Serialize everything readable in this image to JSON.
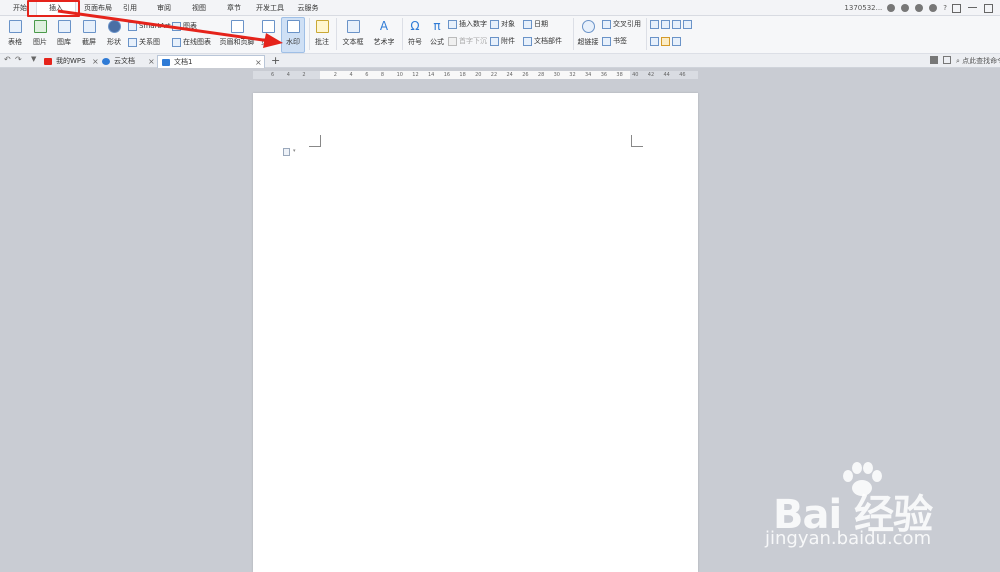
{
  "menu": {
    "tabs": [
      "开始",
      "插入",
      "页面布局",
      "引用",
      "审阅",
      "视图",
      "章节",
      "开发工具",
      "云服务"
    ],
    "active_tab": "插入"
  },
  "account": {
    "user": "1370532...",
    "help": "?"
  },
  "ribbon": {
    "table": "表格",
    "picture": "图片",
    "gallery": "图库",
    "screenshot": "截屏",
    "shape": "形状",
    "smartart": "SmartArt",
    "chart": "图表",
    "relation": "关系图",
    "online_chart": "在线图表",
    "header_footer": "页眉和页脚",
    "page_number": "页码",
    "watermark": "水印",
    "comment": "批注",
    "textbox": "文本框",
    "wordart": "艺术字",
    "symbol": "符号",
    "formula": "公式",
    "insert_number": "插入数字",
    "object": "对象",
    "date": "日期",
    "first_drop": "首字下沉",
    "attachment": "附件",
    "doc_parts": "文档部件",
    "hyperlink": "超链接",
    "cross_ref": "交叉引用",
    "bookmark": "书签"
  },
  "tabbar": {
    "tabs": [
      {
        "label": "我的WPS"
      },
      {
        "label": "云文档"
      },
      {
        "label": "文档1"
      }
    ],
    "add": "+",
    "search_placeholder": "点此查找命令"
  },
  "ruler": {
    "ticks": [
      "6",
      "4",
      "2",
      "",
      "2",
      "4",
      "6",
      "8",
      "10",
      "12",
      "14",
      "16",
      "18",
      "20",
      "22",
      "24",
      "26",
      "28",
      "30",
      "32",
      "34",
      "36",
      "38",
      "40",
      "42",
      "44",
      "46"
    ]
  },
  "watermark_text": {
    "brand": "Bai 经验",
    "url": "jingyan.baidu.com"
  },
  "colors": {
    "annotation": "#e5231b",
    "page": "#ffffff",
    "canvas": "#c9ccd3",
    "accent": "#2f7bd6"
  }
}
